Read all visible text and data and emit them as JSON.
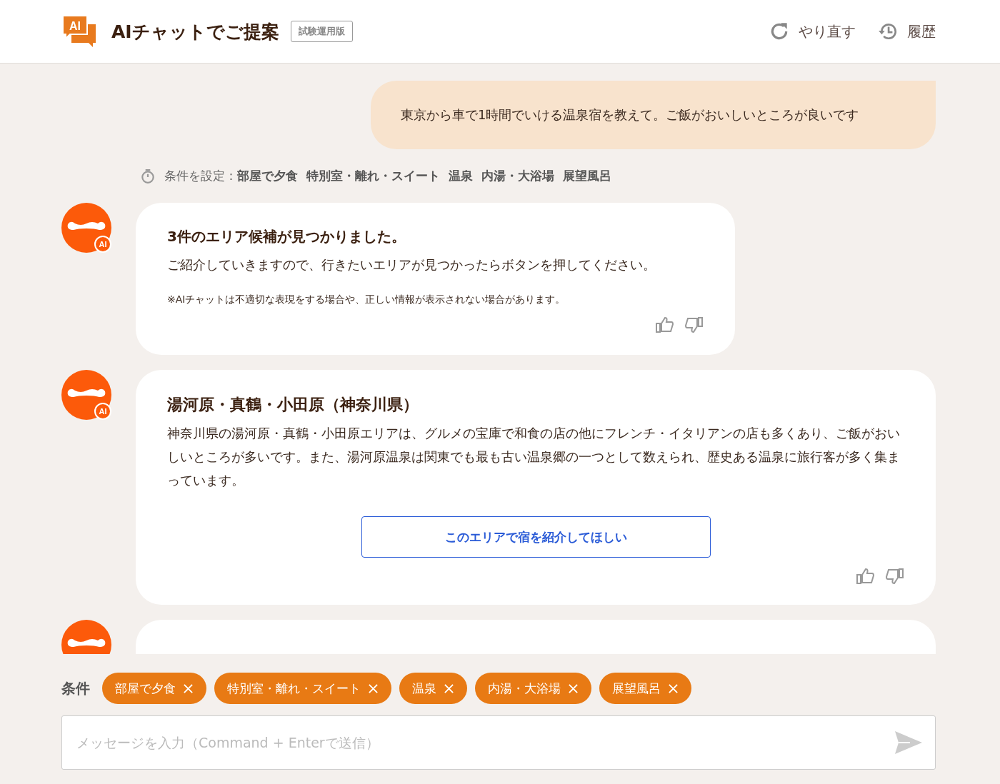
{
  "header": {
    "logo_text": "AI",
    "title": "AIチャットでご提案",
    "badge": "試験運用版",
    "actions": [
      {
        "kind": "redo",
        "label": "やり直す"
      },
      {
        "kind": "history",
        "label": "履歴"
      }
    ]
  },
  "user_message": "東京から車で1時間でいける温泉宿を教えて。ご飯がおいしいところが良いです",
  "conditions_note": {
    "label": "条件を設定：",
    "values": [
      "部屋で夕食",
      "特別室・離れ・スイート",
      "温泉",
      "内湯・大浴場",
      "展望風呂"
    ]
  },
  "messages": [
    {
      "kind": "intro",
      "avatar_badge": "AI",
      "title": "3件のエリア候補が見つかりました。",
      "body": "ご紹介していきますので、行きたいエリアが見つかったらボタンを押してください。",
      "note": "※AIチャットは不適切な表現をする場合や、正しい情報が表示されない場合があります。"
    },
    {
      "kind": "area",
      "avatar_badge": "AI",
      "title": "湯河原・真鶴・小田原（神奈川県）",
      "body": "神奈川県の湯河原・真鶴・小田原エリアは、グルメの宝庫で和食の店の他にフレンチ・イタリアンの店も多くあり、ご飯がおいしいところが多いです。また、湯河原温泉は関東でも最も古い温泉郷の一つとして数えられ、歴史ある温泉に旅行客が多く集まっています。",
      "button": "このエリアで宿を紹介してほしい"
    },
    {
      "kind": "partial"
    }
  ],
  "condition_bar": {
    "label": "条件",
    "chips": [
      "部屋で夕食",
      "特別室・離れ・スイート",
      "温泉",
      "内湯・大浴場",
      "展望風呂"
    ]
  },
  "input": {
    "placeholder": "メッセージを入力（Command + Enterで送信）"
  }
}
